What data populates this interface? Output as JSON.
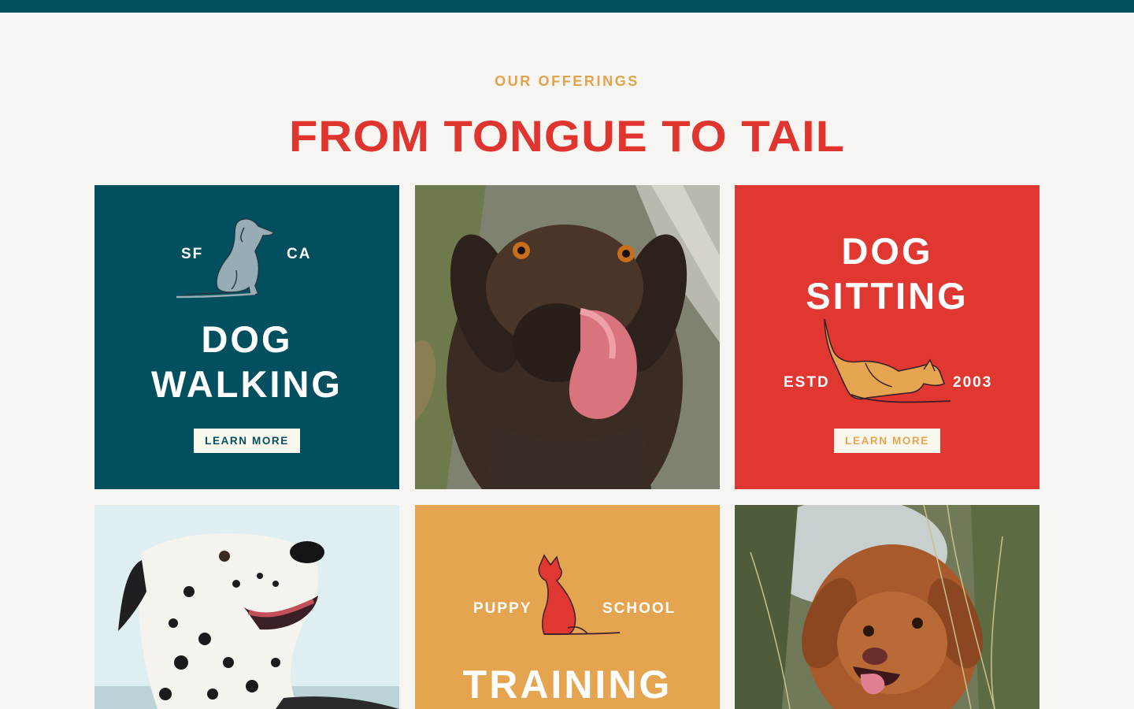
{
  "section": {
    "eyebrow": "OUR OFFERINGS",
    "title": "FROM TONGUE TO TAIL"
  },
  "tiles": {
    "dog_walking": {
      "left_label": "SF",
      "right_label": "CA",
      "title_line1": "DOG",
      "title_line2": "WALKING",
      "button": "LEARN MORE",
      "icon": "sitting-dog-icon"
    },
    "dog_sitting": {
      "title_line1": "DOG",
      "title_line2": "SITTING",
      "left_label": "ESTD",
      "right_label": "2003",
      "button": "LEARN MORE",
      "icon": "stretching-dog-icon"
    },
    "training": {
      "left_label": "PUPPY",
      "right_label": "SCHOOL",
      "title_line1": "TRAINING",
      "icon": "sitting-cat-dog-icon"
    },
    "photos": {
      "photo_1": "labrador-licking-photo",
      "photo_2": "dalmatian-photo",
      "photo_3": "spaniel-photo"
    }
  },
  "colors": {
    "teal": "#02505f",
    "red": "#e0342f",
    "mustard": "#e5a550",
    "cream": "#f6f5f1"
  }
}
